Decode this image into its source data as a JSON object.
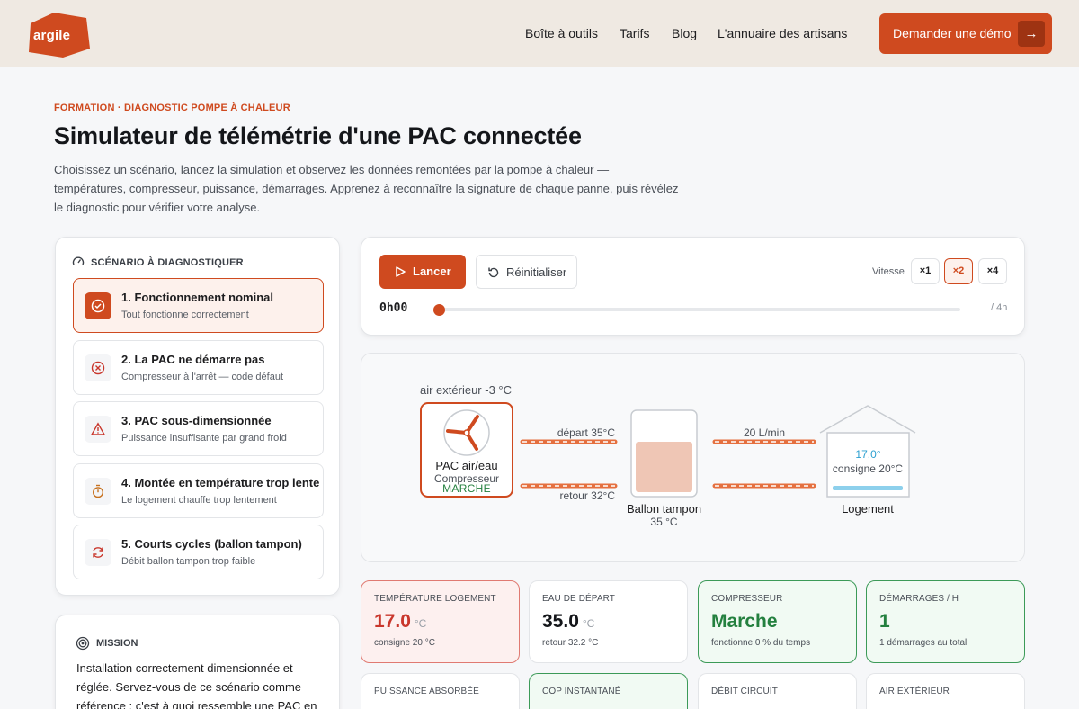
{
  "nav": {
    "logo": "argile",
    "links": [
      "Boîte à outils",
      "Tarifs",
      "Blog",
      "L'annuaire des artisans"
    ],
    "demo_label": "Demander une démo",
    "colors": {
      "brand": "#cf4a1f",
      "nav_bg": "#efe9e2"
    }
  },
  "hero": {
    "eyebrow": "FORMATION · DIAGNOSTIC POMPE À CHALEUR",
    "title": "Simulateur de télémétrie d'une PAC connectée",
    "intro": "Choisissez un scénario, lancez la simulation et observez les données remontées par la pompe à chaleur — températures, compresseur, puissance, démarrages. Apprenez à reconnaître la signature de chaque panne, puis révélez le diagnostic pour vérifier votre analyse."
  },
  "scenarios": {
    "heading": "SCÉNARIO À DIAGNOSTIQUER",
    "items": [
      {
        "title": "1. Fonctionnement nominal",
        "subtitle": "Tout fonctionne correctement",
        "icon": "check-circle-icon",
        "active": true
      },
      {
        "title": "2. La PAC ne démarre pas",
        "subtitle": "Compresseur à l'arrêt — code défaut",
        "icon": "x-circle-icon",
        "active": false
      },
      {
        "title": "3. PAC sous-dimensionnée",
        "subtitle": "Puissance insuffisante par grand froid",
        "icon": "warning-icon",
        "active": false
      },
      {
        "title": "4. Montée en température trop lente",
        "subtitle": "Le logement chauffe trop lentement",
        "icon": "stopwatch-icon",
        "active": false
      },
      {
        "title": "5. Courts cycles (ballon tampon)",
        "subtitle": "Débit ballon tampon trop faible",
        "icon": "refresh-icon",
        "active": false
      }
    ]
  },
  "mission": {
    "heading": "MISSION",
    "text": "Installation correctement dimensionnée et réglée. Servez-vous de ce scénario comme référence : c'est à quoi ressemble une PAC en bonne santé."
  },
  "controls": {
    "launch_label": "Lancer",
    "reset_label": "Réinitialiser",
    "speed_label": "Vitesse",
    "speeds": [
      "×1",
      "×2",
      "×4"
    ],
    "active_speed": "×2",
    "time_current": "0h00",
    "time_total": "/ 4h",
    "progress": 0
  },
  "diagram": {
    "outdoor_air": "air extérieur -3 °C",
    "pac_name": "PAC air/eau",
    "compressor_label": "Compresseur",
    "compressor_state": "MARCHE",
    "supply_label": "départ 35°C",
    "return_label": "retour 32°C",
    "flow_label": "20 L/min",
    "tank_name": "Ballon tampon",
    "tank_temp": "35 °C",
    "tank_fill": 0.72,
    "house_temp": "17.0°",
    "house_setpoint": "consigne 20°C",
    "house_name": "Logement"
  },
  "metrics": [
    {
      "label": "TEMPÉRATURE LOGEMENT",
      "value": "17.0",
      "unit": "°C",
      "sub": "consigne 20 °C",
      "tone": "red"
    },
    {
      "label": "EAU DE DÉPART",
      "value": "35.0",
      "unit": "°C",
      "sub": "retour 32.2 °C",
      "tone": "neutral"
    },
    {
      "label": "COMPRESSEUR",
      "value": "Marche",
      "unit": "",
      "sub": "fonctionne 0 % du temps",
      "tone": "green"
    },
    {
      "label": "DÉMARRAGES / H",
      "value": "1",
      "unit": "",
      "sub": "1 démarrages au total",
      "tone": "green"
    },
    {
      "label": "PUISSANCE ABSORBÉE",
      "value": "",
      "unit": "",
      "sub": "",
      "tone": "neutral"
    },
    {
      "label": "COP INSTANTANÉ",
      "value": "",
      "unit": "",
      "sub": "",
      "tone": "green"
    },
    {
      "label": "DÉBIT CIRCUIT",
      "value": "",
      "unit": "",
      "sub": "",
      "tone": "neutral"
    },
    {
      "label": "AIR EXTÉRIEUR",
      "value": "",
      "unit": "",
      "sub": "",
      "tone": "neutral"
    }
  ]
}
